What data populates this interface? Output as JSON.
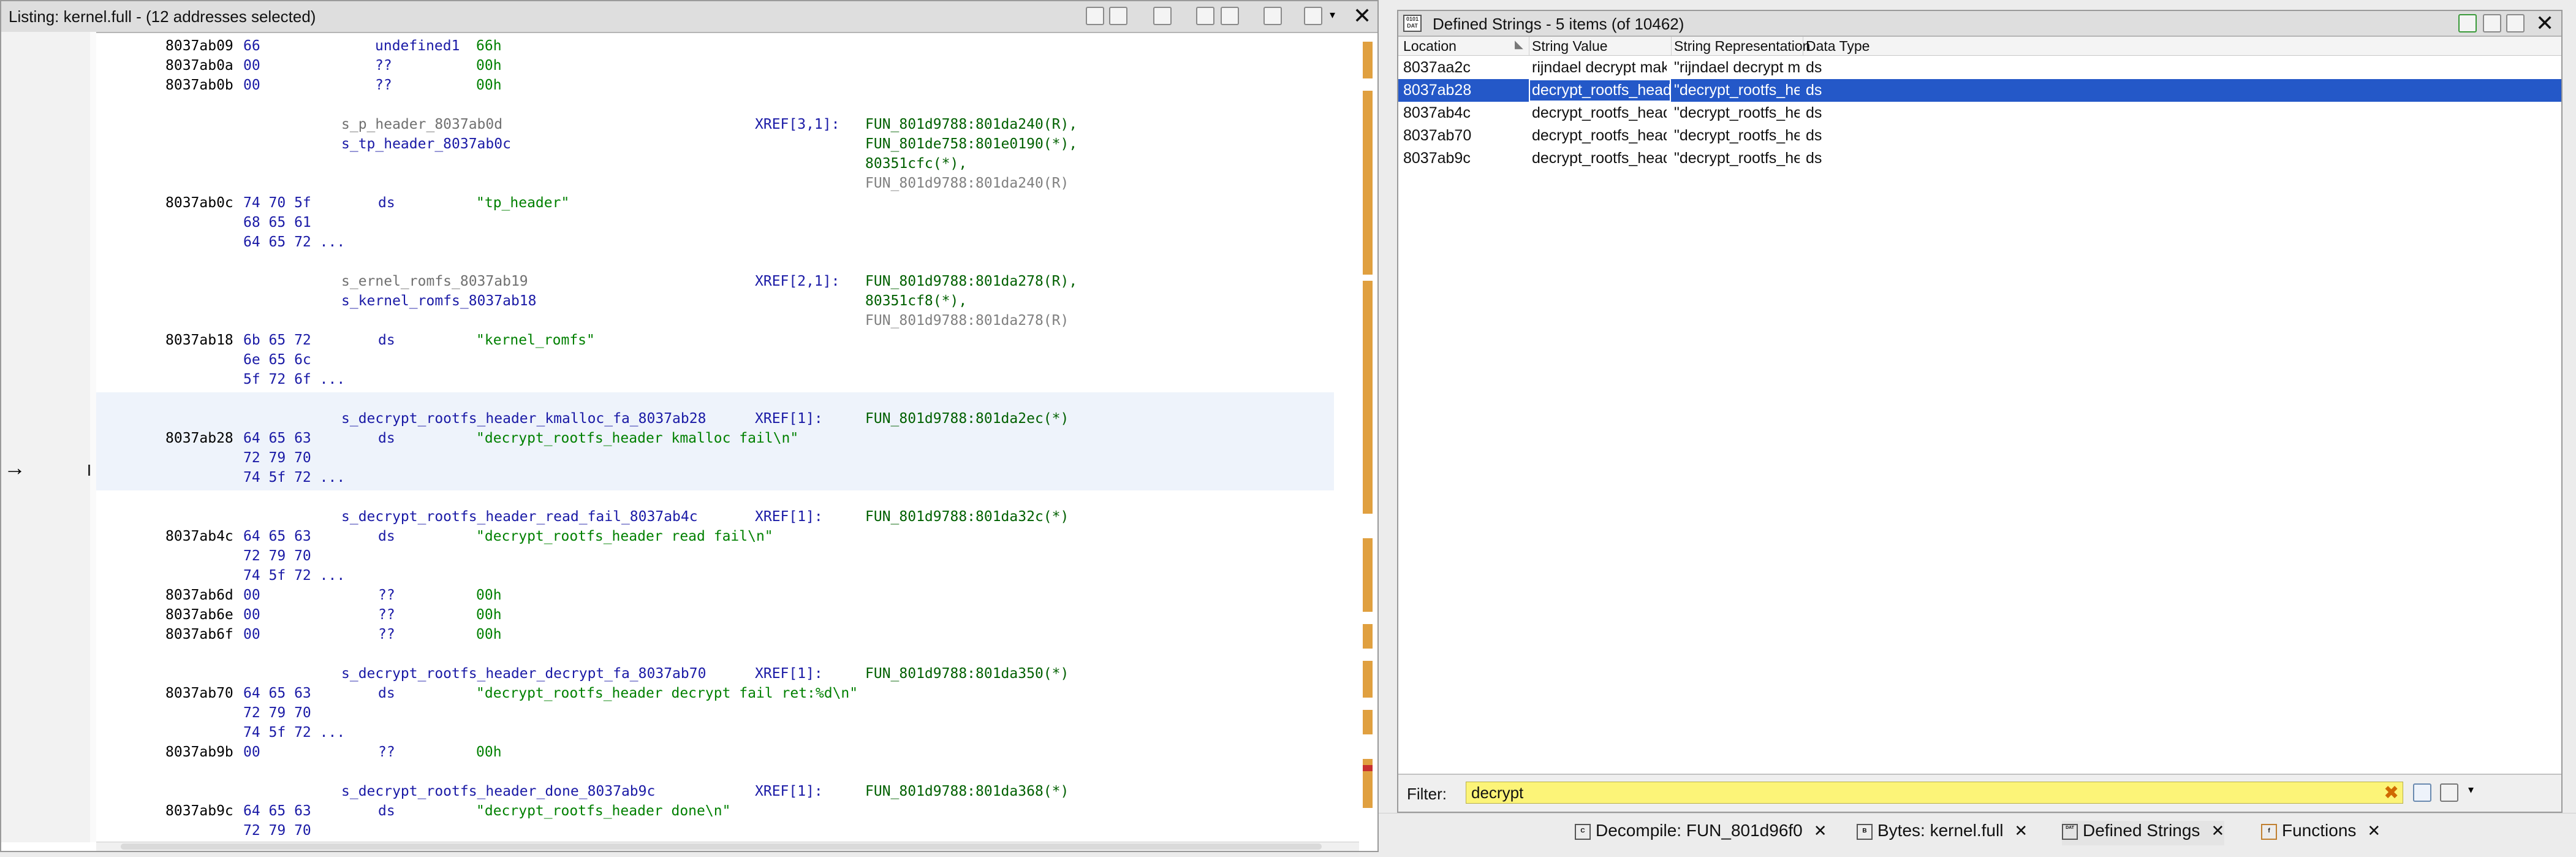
{
  "listing": {
    "title": "Listing:  kernel.full - (12 addresses selected)",
    "close": "✕",
    "lines": [
      {
        "addr": "8037ab09",
        "bytes": "66",
        "mnem": "undefined1",
        "ops": "66h"
      },
      {
        "addr": "8037ab0a",
        "bytes": "00",
        "mnem": "??",
        "ops": "00h"
      },
      {
        "addr": "8037ab0b",
        "bytes": "00",
        "mnem": "??",
        "ops": "00h"
      }
    ],
    "blocks": [
      {
        "label1": "s_p_header_8037ab0d",
        "label2": "s_tp_header_8037ab0c",
        "xref": "XREF[3,1]:",
        "xrefs": [
          "FUN_801d9788:801da240(R),",
          "FUN_801de758:801e0190(*),",
          "80351cfc(*),",
          "FUN_801d9788:801da240(R)"
        ],
        "addr": "8037ab0c",
        "bytes": [
          "74 70 5f",
          "68 65 61",
          "64 65 72 ..."
        ],
        "mnem": "ds",
        "ops": "\"tp_header\""
      },
      {
        "label1": "s_ernel_romfs_8037ab19",
        "label2": "s_kernel_romfs_8037ab18",
        "xref": "XREF[2,1]:",
        "xrefs": [
          "FUN_801d9788:801da278(R),",
          "80351cf8(*),",
          "FUN_801d9788:801da278(R)"
        ],
        "addr": "8037ab18",
        "bytes": [
          "6b 65 72",
          "6e 65 6c",
          "5f 72 6f ..."
        ],
        "mnem": "ds",
        "ops": "\"kernel_romfs\""
      },
      {
        "label": "s_decrypt_rootfs_header_kmalloc_fa_8037ab28",
        "xref": "XREF[1]:",
        "xrefs": [
          "FUN_801d9788:801da2ec(*)"
        ],
        "addr": "8037ab28",
        "bytes": [
          "64 65 63",
          "72 79 70",
          "74 5f 72 ..."
        ],
        "mnem": "ds",
        "ops": "\"decrypt_rootfs_header kmalloc fail\\n\""
      },
      {
        "label": "s_decrypt_rootfs_header_read_fail_8037ab4c",
        "xref": "XREF[1]:",
        "xrefs": [
          "FUN_801d9788:801da32c(*)"
        ],
        "addr": "8037ab4c",
        "bytes": [
          "64 65 63",
          "72 79 70",
          "74 5f 72 ..."
        ],
        "mnem": "ds",
        "ops": "\"decrypt_rootfs_header read fail\\n\""
      },
      {
        "label": "s_decrypt_rootfs_header_decrypt_fa_8037ab70",
        "xref": "XREF[1]:",
        "xrefs": [
          "FUN_801d9788:801da350(*)"
        ],
        "addr": "8037ab70",
        "bytes": [
          "64 65 63",
          "72 79 70",
          "74 5f 72 ..."
        ],
        "mnem": "ds",
        "ops": "\"decrypt_rootfs_header decrypt fail ret:%d\\n\""
      },
      {
        "label": "s_decrypt_rootfs_header_done_8037ab9c",
        "xref": "XREF[1]:",
        "xrefs": [
          "FUN_801d9788:801da368(*)"
        ],
        "addr": "8037ab9c",
        "bytes": [
          "64 65 63",
          "72 79 70"
        ],
        "mnem": "ds",
        "ops": "\"decrypt_rootfs_header done\\n\""
      }
    ],
    "pad_lines": [
      {
        "addr": "8037ab6d",
        "bytes": "00",
        "mnem": "??",
        "ops": "00h"
      },
      {
        "addr": "8037ab6e",
        "bytes": "00",
        "mnem": "??",
        "ops": "00h"
      },
      {
        "addr": "8037ab6f",
        "bytes": "00",
        "mnem": "??",
        "ops": "00h"
      }
    ],
    "pad_line2": {
      "addr": "8037ab9b",
      "bytes": "00",
      "mnem": "??",
      "ops": "00h"
    },
    "cursor_arrow": "→"
  },
  "strings": {
    "title": "Defined Strings - 5 items (of 10462)",
    "icon_text": "0101 DAT",
    "columns": [
      "Location",
      "String Value",
      "String Representation",
      "Data Type"
    ],
    "rows": [
      {
        "loc": "8037aa2c",
        "val": "rijndael decrypt makeKey fail",
        "rep": "\"rijndael decrypt makeKey fail\\n\"",
        "type": "ds",
        "selected": false
      },
      {
        "loc": "8037ab28",
        "val": "decrypt_rootfs_header kmalloc fail",
        "rep": "\"decrypt_rootfs_header kmalloc ...",
        "type": "ds",
        "selected": true
      },
      {
        "loc": "8037ab4c",
        "val": "decrypt_rootfs_header read fail",
        "rep": "\"decrypt_rootfs_header read fail...",
        "type": "ds",
        "selected": false
      },
      {
        "loc": "8037ab70",
        "val": "decrypt_rootfs_header decrypt fail re...",
        "rep": "\"decrypt_rootfs_header decrypt f...",
        "type": "ds",
        "selected": false
      },
      {
        "loc": "8037ab9c",
        "val": "decrypt_rootfs_header done",
        "rep": "\"decrypt_rootfs_header done\\n\"",
        "type": "ds",
        "selected": false
      }
    ],
    "filter_label": "Filter:",
    "filter_value": "decrypt",
    "close": "✕"
  },
  "tabs": [
    {
      "label": "Decompile: FUN_801d96f0",
      "icon": "C"
    },
    {
      "label": "Bytes: kernel.full",
      "icon": "B"
    },
    {
      "label": "Defined Strings",
      "icon": "DAT"
    },
    {
      "label": "Functions",
      "icon": "f"
    }
  ],
  "colors": {
    "selection": "#2458c8",
    "filter_bg": "#fcf478",
    "label_blue": "#1a1aa6",
    "operand_green": "#008000"
  }
}
